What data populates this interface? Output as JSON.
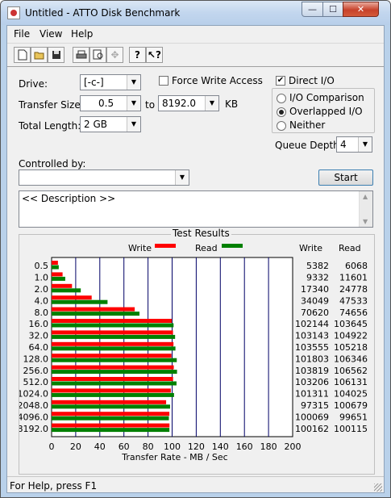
{
  "window": {
    "title": "Untitled - ATTO Disk Benchmark"
  },
  "menu": [
    "File",
    "View",
    "Help"
  ],
  "toolbar": {
    "icons": [
      "new-file-icon",
      "open-folder-icon",
      "save-icon",
      "print-icon",
      "print-preview-icon",
      "move-icon",
      "help-icon",
      "context-help-icon"
    ]
  },
  "form": {
    "drive_label": "Drive:",
    "drive_value": "[-c-]",
    "force_write_label": "Force Write Access",
    "direct_io_label": "Direct I/O",
    "transfer_size_label": "Transfer Size:",
    "transfer_from": "0.5",
    "to_label": "to",
    "transfer_to": "8192.0",
    "kb_label": "KB",
    "total_length_label": "Total Length:",
    "total_length_value": "2 GB",
    "io_comparison_label": "I/O Comparison",
    "overlapped_io_label": "Overlapped I/O",
    "neither_label": "Neither",
    "queue_depth_label": "Queue Depth:",
    "queue_depth_value": "4",
    "controlled_by_label": "Controlled by:",
    "controlled_by_value": "",
    "start_label": "Start",
    "description": "<< Description >>",
    "direct_io_checked": true,
    "force_write_checked": false,
    "selected_mode": "Overlapped I/O"
  },
  "results": {
    "title": "Test Results",
    "write_legend": "Write",
    "read_legend": "Read",
    "write_col": "Write",
    "read_col": "Read",
    "write_color": "#ff0000",
    "read_color": "#008000"
  },
  "chart_data": {
    "type": "bar",
    "categories": [
      "0.5",
      "1.0",
      "2.0",
      "4.0",
      "8.0",
      "16.0",
      "32.0",
      "64.0",
      "128.0",
      "256.0",
      "512.0",
      "1024.0",
      "2048.0",
      "4096.0",
      "8192.0"
    ],
    "series": [
      {
        "name": "Write",
        "values": [
          5382,
          9332,
          17340,
          34049,
          70620,
          102144,
          103143,
          103555,
          101803,
          103819,
          103206,
          101311,
          97315,
          100069,
          100162
        ]
      },
      {
        "name": "Read",
        "values": [
          6068,
          11601,
          24778,
          47533,
          74656,
          103645,
          104922,
          105218,
          106346,
          106562,
          106131,
          104025,
          100679,
          99651,
          100115
        ]
      }
    ],
    "xlabel": "Transfer Rate - MB / Sec",
    "xticks": [
      0,
      20,
      40,
      60,
      80,
      100,
      120,
      140,
      160,
      180,
      200
    ],
    "xlim": [
      0,
      200
    ],
    "orientation": "horizontal",
    "grid": true
  },
  "status": {
    "text": "For Help, press F1"
  }
}
